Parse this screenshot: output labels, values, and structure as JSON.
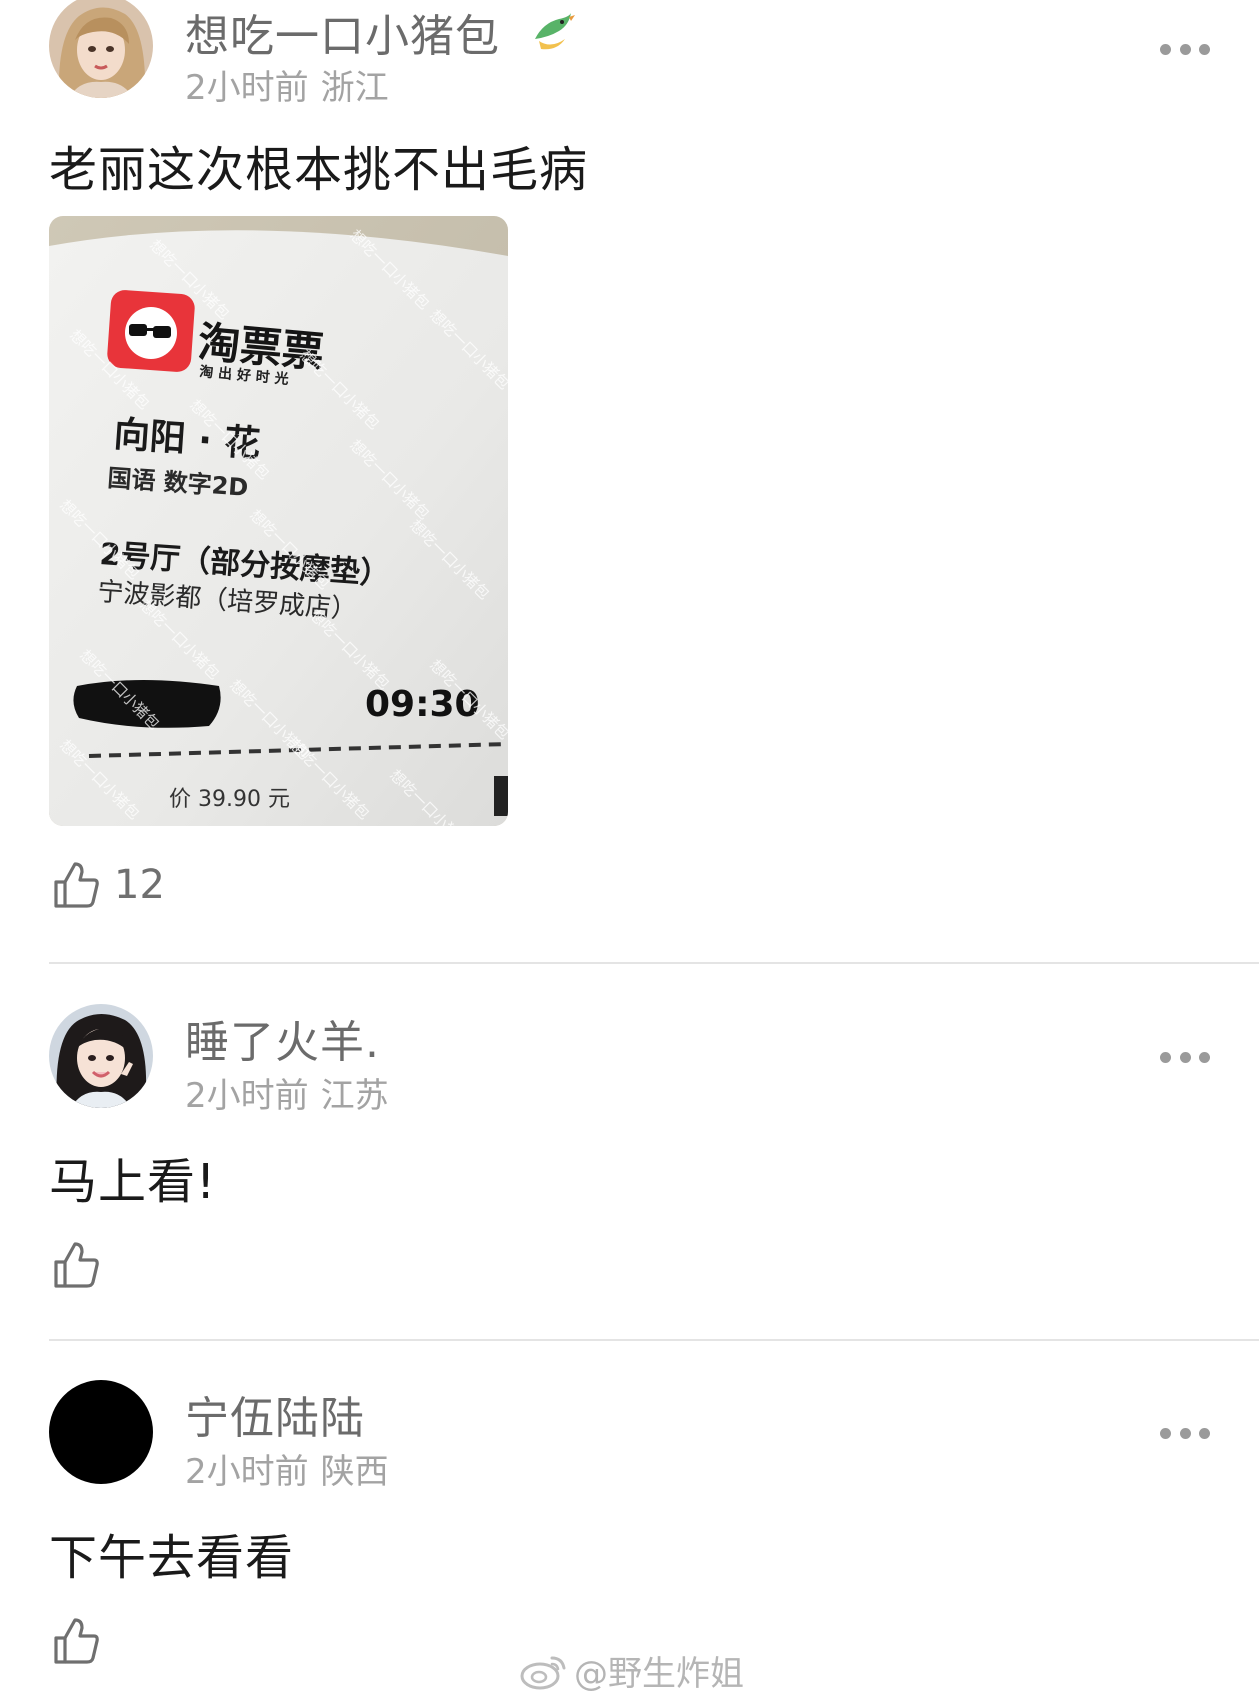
{
  "comments": [
    {
      "username": "想吃一口小猪包",
      "time": "2小时前",
      "location": "浙江",
      "text": "老丽这次根本挑不出毛病",
      "likes": "12",
      "badge_icon": "bird-badge-icon",
      "avatar_icon": "avatar-girl-blonde-icon",
      "photo": {
        "brand": "淘票票",
        "slogan": "淘 出 好 时 光",
        "movie": "向阳 · 花",
        "format": "国语  数字2D",
        "hall": "2号厅（部分按摩垫）",
        "cinema": "宁波影都（培罗成店）",
        "showtime": "09:30",
        "price": "价 39.90 元",
        "watermark": "想吃一口小猪包"
      }
    },
    {
      "username": "睡了火羊.",
      "time": "2小时前",
      "location": "江苏",
      "text": "马上看!",
      "likes": "",
      "avatar_icon": "avatar-girl-dark-hair-icon"
    },
    {
      "username": "宁伍陆陆",
      "time": "2小时前",
      "location": "陕西",
      "text": "下午去看看",
      "likes": "",
      "avatar_icon": "avatar-black-circle-icon"
    }
  ],
  "footer": {
    "watermark": "@野生炸姐",
    "icon": "weibo-logo-icon"
  },
  "colors": {
    "username": "#6b6b6b",
    "meta": "#a3a3a3",
    "text": "#1a1a1a",
    "divider": "#e4e4e4",
    "ticket_red": "#e8343a"
  }
}
